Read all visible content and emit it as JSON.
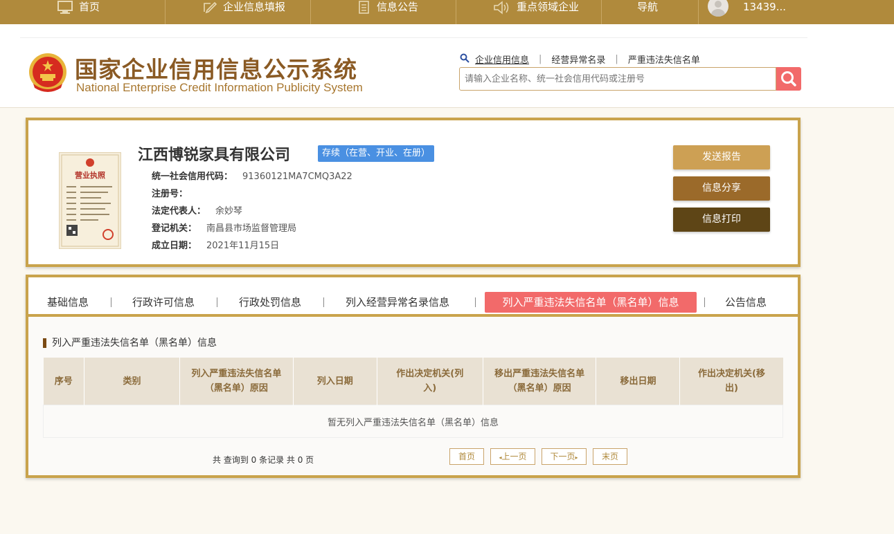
{
  "topnav": {
    "items": [
      {
        "label": "首页",
        "icon": "monitor-icon"
      },
      {
        "label": "企业信息填报",
        "icon": "edit-icon"
      },
      {
        "label": "信息公告",
        "icon": "document-icon"
      },
      {
        "label": "重点领域企业",
        "icon": "speaker-icon"
      },
      {
        "label": "导航",
        "icon": ""
      }
    ],
    "user": "13439..."
  },
  "header": {
    "title_cn": "国家企业信用信息公示系统",
    "title_en": "National Enterprise Credit Information Publicity System",
    "search_links": [
      "企业信用信息",
      "经营异常名录",
      "严重违法失信名单"
    ],
    "search_placeholder": "请输入企业名称、统一社会信用代码或注册号"
  },
  "company": {
    "name": "江西博锐家具有限公司",
    "status": "存续（在营、开业、在册）",
    "license_title": "营业执照",
    "fields": [
      {
        "label": "统一社会信用代码：",
        "value": "91360121MA7CMQ3A22"
      },
      {
        "label": "注册号：",
        "value": ""
      },
      {
        "label": "法定代表人：",
        "value": "余妙琴"
      },
      {
        "label": "登记机关：",
        "value": "南昌县市场监督管理局"
      },
      {
        "label": "成立日期：",
        "value": "2021年11月15日"
      }
    ],
    "buttons": {
      "send_report": "发送报告",
      "share": "信息分享",
      "print": "信息打印"
    },
    "button_colors": [
      "#cda054",
      "#9b6a2a",
      "#5e4516"
    ]
  },
  "tabs": [
    {
      "label": "基础信息"
    },
    {
      "label": "行政许可信息"
    },
    {
      "label": "行政处罚信息"
    },
    {
      "label": "列入经营异常名录信息"
    },
    {
      "label": "列入严重违法失信名单（黑名单）信息",
      "active": true
    },
    {
      "label": "公告信息"
    }
  ],
  "section": {
    "title": "列入严重违法失信名单（黑名单）信息",
    "columns": [
      "序号",
      "类别",
      "列入严重违法失信名单（黑名单）原因",
      "列入日期",
      "作出决定机关(列入)",
      "移出严重违法失信名单（黑名单）原因",
      "移出日期",
      "作出决定机关(移出)"
    ],
    "empty_text": "暂无列入严重违法失信名单（黑名单）信息",
    "summary": "共 查询到 0 条记录 共 0 页",
    "pager": {
      "first": "首页",
      "prev": "上一页",
      "next": "下一页",
      "last": "末页"
    }
  },
  "colors": {
    "nav_bg": "#b08a3c",
    "border_gold": "#c9a34c",
    "active_tab": "#f26a6a",
    "badge_blue": "#4a90e2"
  }
}
